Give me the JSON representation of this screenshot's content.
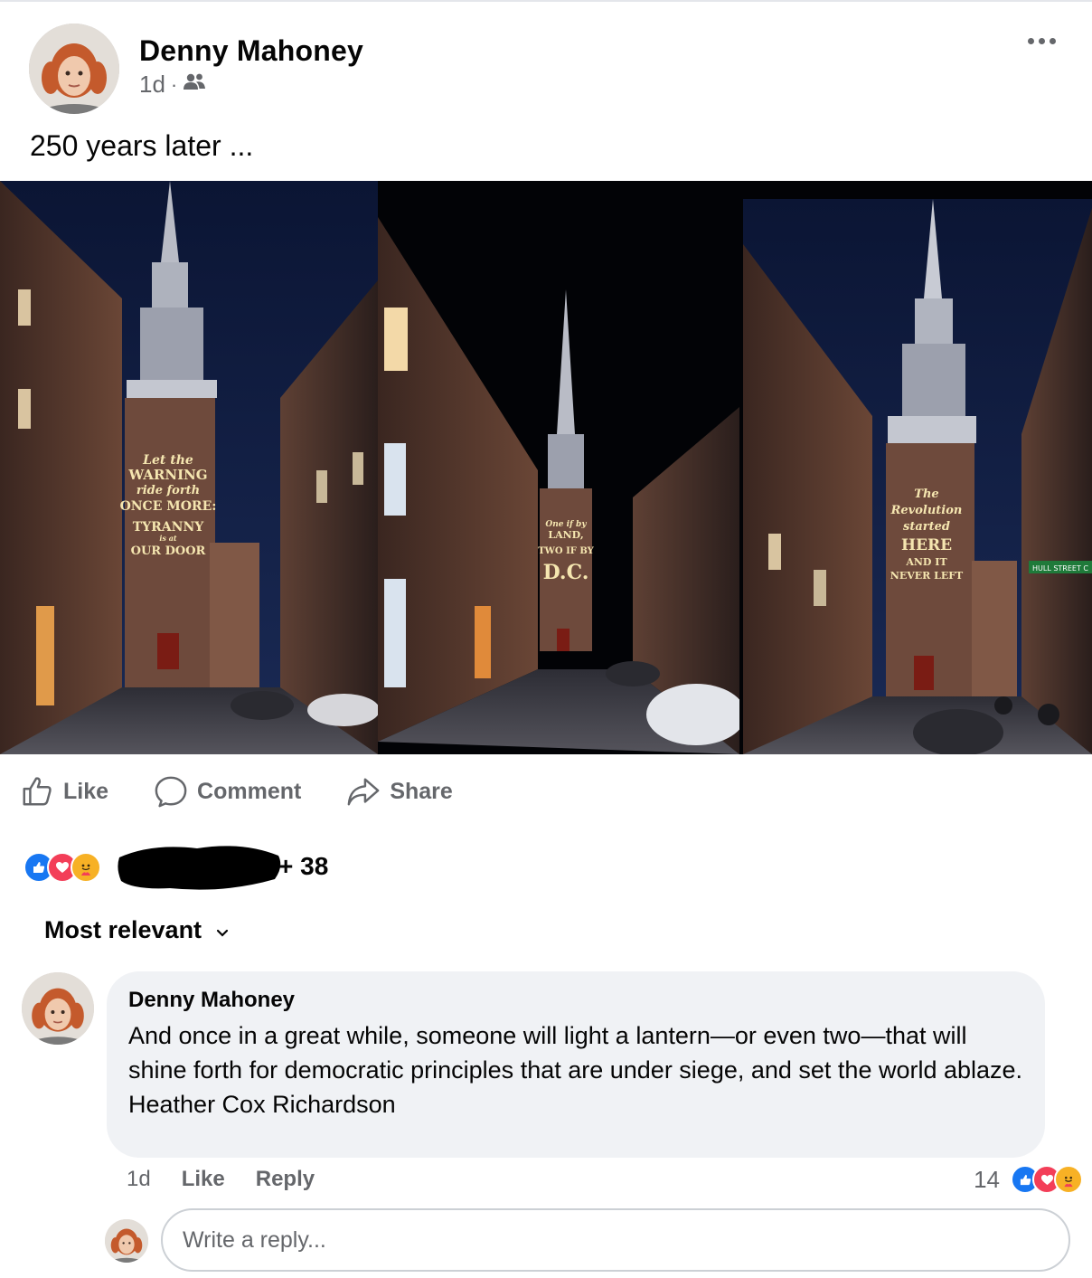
{
  "post": {
    "author": "Denny Mahoney",
    "time": "1d",
    "audience_icon": "friends-icon",
    "text": "250 years later ...",
    "image": {
      "projections": [
        [
          "Let the",
          "WARNING",
          "ride forth",
          "ONCE MORE:",
          "TYRANNY",
          "is at",
          "OUR DOOR"
        ],
        [
          "One if by",
          "LAND,",
          "TWO IF BY",
          "D.C."
        ],
        [
          "The",
          "Revolution",
          "started",
          "HERE",
          "AND IT",
          "NEVER LEFT"
        ]
      ],
      "street_sign": "HULL STREET C"
    }
  },
  "actions": {
    "like": "Like",
    "comment": "Comment",
    "share": "Share"
  },
  "reactions": {
    "icons": [
      "like",
      "love",
      "care"
    ],
    "others": "+ 38"
  },
  "sort": {
    "label": "Most relevant"
  },
  "comment": {
    "author": "Denny Mahoney",
    "body": "And once in a great while, someone will light a lantern—or even two—that will shine forth for democratic principles that are under siege, and set the world ablaze.",
    "signature": "Heather Cox Richardson",
    "time": "1d",
    "like_label": "Like",
    "reply_label": "Reply",
    "reaction_count": "14"
  },
  "reply_box": {
    "placeholder": "Write a reply..."
  },
  "colors": {
    "like_blue": "#1877f2",
    "love_red": "#f33e58",
    "care_yellow": "#f7b125",
    "secondary_text": "#65676b",
    "bubble_bg": "#f0f2f5"
  }
}
